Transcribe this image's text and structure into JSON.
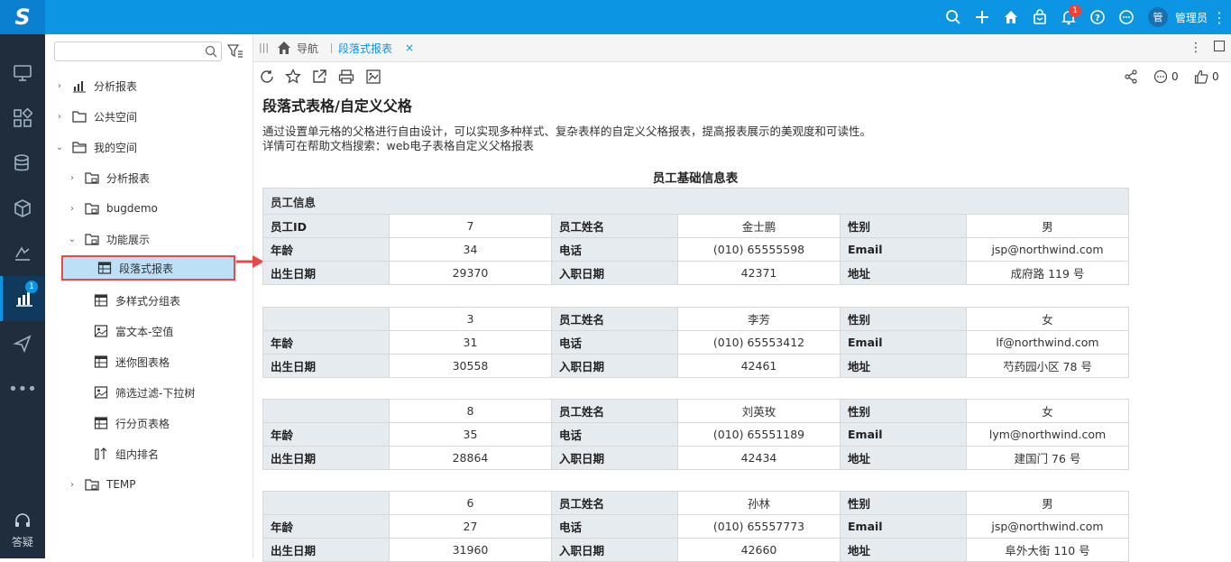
{
  "header": {
    "logo": "S",
    "notification_count": "1",
    "user_avatar": "管",
    "user_name": "管理员"
  },
  "rail": {
    "active_badge": "1",
    "help_label": "答疑"
  },
  "tree": {
    "search_placeholder": "",
    "items": [
      {
        "label": "分析报表"
      },
      {
        "label": "公共空间"
      },
      {
        "label": "我的空间"
      },
      {
        "label": "分析报表"
      },
      {
        "label": "bugdemo"
      },
      {
        "label": "功能展示"
      },
      {
        "label": "段落式报表"
      },
      {
        "label": "多样式分组表"
      },
      {
        "label": "富文本-空值"
      },
      {
        "label": "迷你图表格"
      },
      {
        "label": "筛选过滤-下拉树"
      },
      {
        "label": "行分页表格"
      },
      {
        "label": "组内排名"
      },
      {
        "label": "TEMP"
      }
    ]
  },
  "tabs": {
    "home_label": "导航",
    "active_label": "段落式报表",
    "close": "×"
  },
  "social": {
    "comments": "0",
    "likes": "0"
  },
  "content": {
    "title": "段落式表格/自定义父格",
    "desc_line1": "通过设置单元格的父格进行自由设计，可以实现多种样式、复杂表样的自定义父格报表，提高报表展示的美观度和可读性。",
    "desc_line2": "详情可在帮助文档搜索：web电子表格自定义父格报表",
    "report_title": "员工基础信息表",
    "section_header": "员工信息",
    "labels": {
      "emp_id": "员工ID",
      "emp_name": "员工姓名",
      "gender": "性别",
      "age": "年龄",
      "phone": "电话",
      "email": "Email",
      "birth": "出生日期",
      "hire": "入职日期",
      "address": "地址"
    },
    "employees": [
      {
        "id": "7",
        "name": "金士鹏",
        "gender": "男",
        "age": "34",
        "phone": "(010) 65555598",
        "email": "jsp@northwind.com",
        "birth": "29370",
        "hire": "42371",
        "address": "成府路 119 号"
      },
      {
        "id": "3",
        "name": "李芳",
        "gender": "女",
        "age": "31",
        "phone": "(010) 65553412",
        "email": "lf@northwind.com",
        "birth": "30558",
        "hire": "42461",
        "address": "芍药园小区 78 号"
      },
      {
        "id": "8",
        "name": "刘英玫",
        "gender": "女",
        "age": "35",
        "phone": "(010) 65551189",
        "email": "lym@northwind.com",
        "birth": "28864",
        "hire": "42434",
        "address": "建国门 76 号"
      },
      {
        "id": "6",
        "name": "孙林",
        "gender": "男",
        "age": "27",
        "phone": "(010) 65557773",
        "email": "jsp@northwind.com",
        "birth": "31960",
        "hire": "42660",
        "address": "阜外大街 110 号"
      }
    ]
  }
}
